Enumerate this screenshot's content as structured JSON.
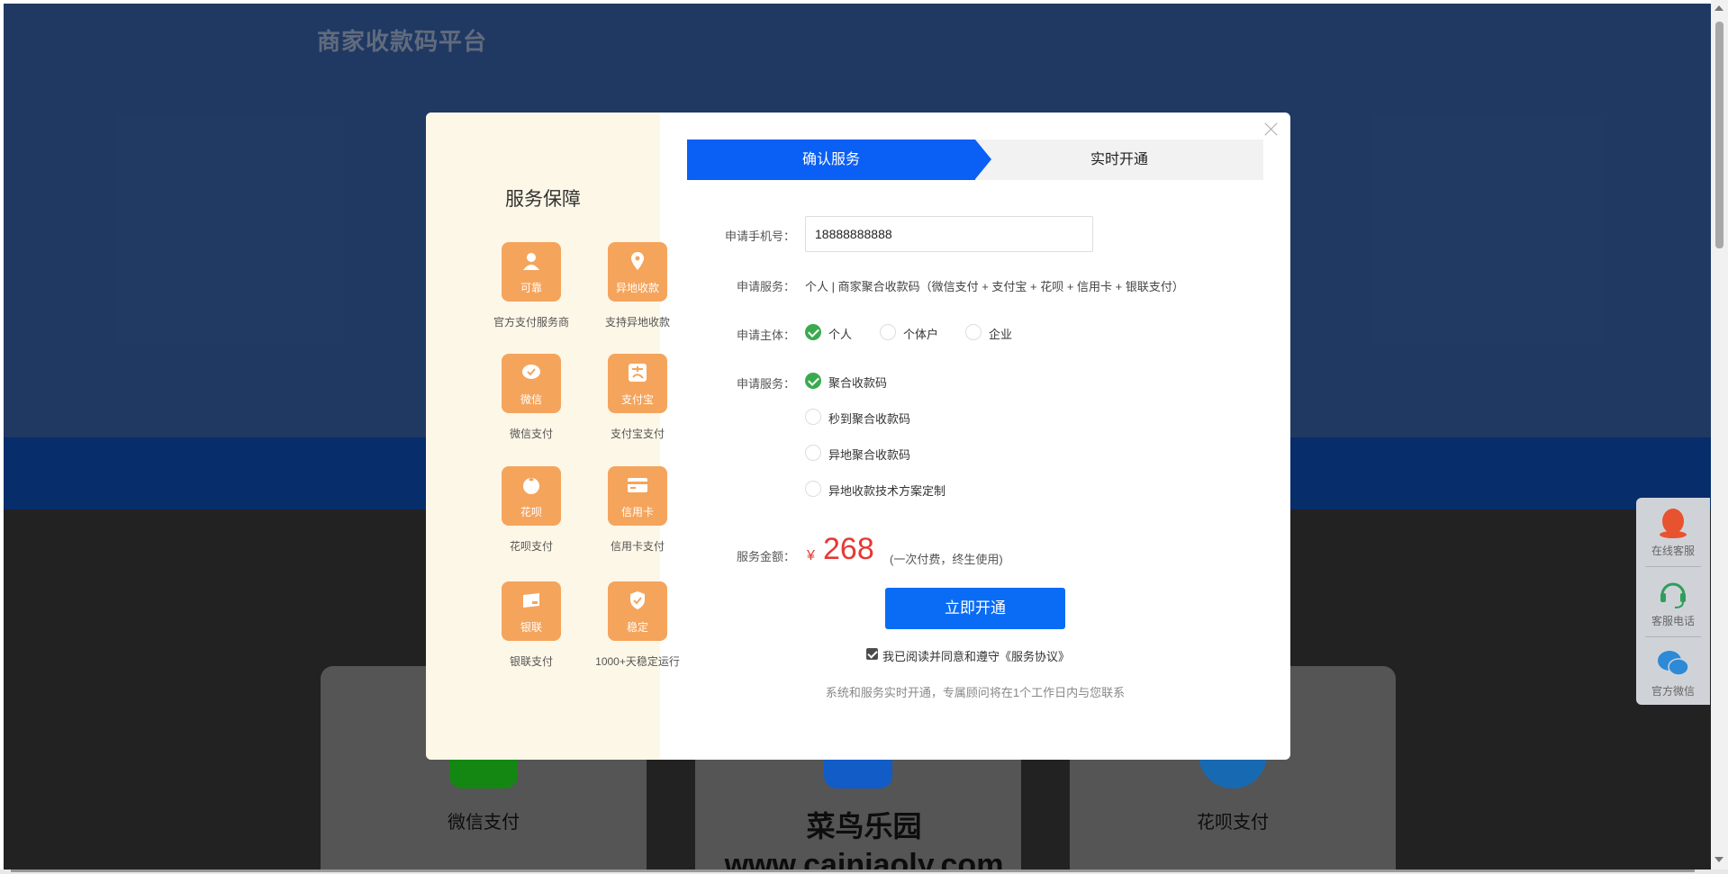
{
  "site": {
    "title": "商家收款码平台"
  },
  "background_cards": [
    {
      "label": "微信支付",
      "color": "#1aad19"
    },
    {
      "label": "",
      "color": "#1677ff"
    },
    {
      "label": "花呗支付",
      "color": "#1e88e5"
    }
  ],
  "watermark": {
    "line1": "菜鸟乐园",
    "line2": "www.cainiaoly.com"
  },
  "float_bar": {
    "items": [
      {
        "label": "在线客服",
        "icon": "qq-icon"
      },
      {
        "label": "客服电话",
        "icon": "headset-icon"
      },
      {
        "label": "官方微信",
        "icon": "wechat-icon"
      }
    ]
  },
  "modal": {
    "left": {
      "title": "服务保障",
      "features": [
        {
          "tile": "可靠",
          "caption": "官方支付服务商",
          "icon": "user-icon"
        },
        {
          "tile": "异地收款",
          "caption": "支持异地收款",
          "icon": "location-pin-icon"
        },
        {
          "tile": "微信",
          "caption": "微信支付",
          "icon": "wechat-icon"
        },
        {
          "tile": "支付宝",
          "caption": "支付宝支付",
          "icon": "alipay-icon"
        },
        {
          "tile": "花呗",
          "caption": "花呗支付",
          "icon": "huabei-icon"
        },
        {
          "tile": "信用卡",
          "caption": "信用卡支付",
          "icon": "credit-card-icon"
        },
        {
          "tile": "银联",
          "caption": "银联支付",
          "icon": "unionpay-icon"
        },
        {
          "tile": "稳定",
          "caption": "1000+天稳定运行",
          "icon": "shield-icon"
        }
      ]
    },
    "steps": {
      "active": "确认服务",
      "next": "实时开通"
    },
    "form": {
      "phone_label": "申请手机号：",
      "phone_value": "18888888888",
      "service_label": "申请服务：",
      "service_text": "个人 | 商家聚合收款码（微信支付 + 支付宝 + 花呗 + 信用卡 + 银联支付）",
      "subject_label": "申请主体：",
      "subject_options": [
        {
          "label": "个人",
          "checked": true
        },
        {
          "label": "个体户",
          "checked": false
        },
        {
          "label": "企业",
          "checked": false
        }
      ],
      "service2_label": "申请服务：",
      "service_options": [
        {
          "label": "聚合收款码",
          "checked": true
        },
        {
          "label": "秒到聚合收款码",
          "checked": false
        },
        {
          "label": "异地聚合收款码",
          "checked": false
        },
        {
          "label": "异地收款技术方案定制",
          "checked": false
        }
      ],
      "amount_label": "服务金额：",
      "currency": "¥",
      "amount": "268",
      "amount_note": "(一次付费，终生使用)",
      "submit_label": "立即开通",
      "agree_text": "我已阅读并同意和遵守《服务协议》",
      "agree_checked": true,
      "bottom_note": "系统和服务实时开通，专属顾问将在1个工作日内与您联系"
    }
  },
  "colors": {
    "primary": "#0a5ff5",
    "price": "#e53935",
    "tile": "#f5a45c",
    "check": "#3aaa4f"
  }
}
